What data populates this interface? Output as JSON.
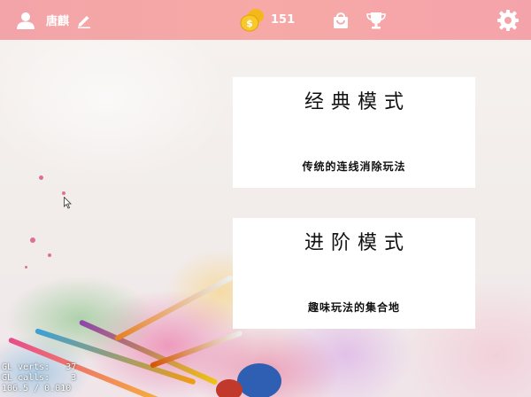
{
  "header": {
    "username": "唐麒",
    "coins": "151",
    "icons": {
      "user": "user-icon",
      "edit": "pencil-icon",
      "coin": "coin-icon",
      "shop": "shopping-bag-icon",
      "trophy": "trophy-icon",
      "settings": "gear-icon"
    }
  },
  "modes": [
    {
      "title": "经典模式",
      "desc": "传统的连线消除玩法"
    },
    {
      "title": "进阶模式",
      "desc": "趣味玩法的集合地"
    }
  ],
  "debug": {
    "line1": "GL verts:   37",
    "line2": "GL calls:    3",
    "line3": "106.5 / 0.010"
  },
  "colors": {
    "topbar": "#f3a4a8",
    "card": "#ffffff",
    "coin": "#f5c518"
  }
}
